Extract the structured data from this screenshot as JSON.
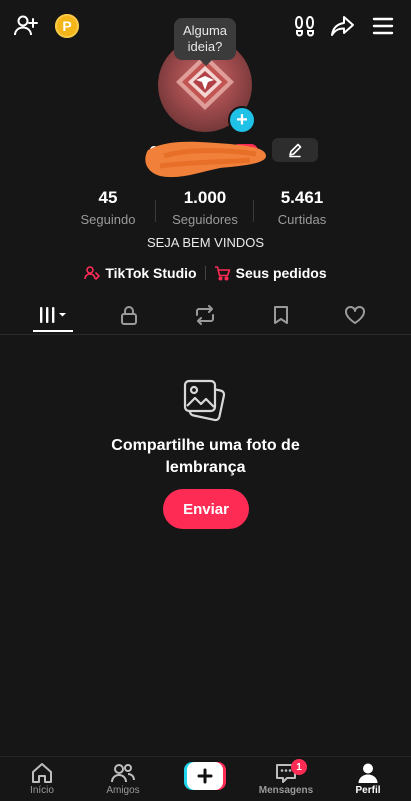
{
  "header": {
    "coin_label": "P"
  },
  "profile": {
    "tooltip": "Alguma ideia?",
    "add_avatar_symbol": "+",
    "bio": "SEJA BEM VINDOS"
  },
  "stats": [
    {
      "value": "45",
      "label": "Seguindo"
    },
    {
      "value": "1.000",
      "label": "Seguidores"
    },
    {
      "value": "5.461",
      "label": "Curtidas"
    }
  ],
  "links": {
    "studio": "TikTok Studio",
    "orders": "Seus pedidos"
  },
  "empty_state": {
    "text_line1": "Compartilhe uma foto de",
    "text_line2": "lembrança",
    "button": "Enviar"
  },
  "bottom_nav": {
    "items": [
      {
        "label": "Início",
        "icon": "home-icon"
      },
      {
        "label": "Amigos",
        "icon": "friends-icon"
      },
      {
        "label": "",
        "icon": "create-icon"
      },
      {
        "label": "Mensagens",
        "icon": "inbox-icon"
      },
      {
        "label": "Perfil",
        "icon": "profile-icon"
      }
    ],
    "messages_badge": "1"
  },
  "colors": {
    "background": "#161616",
    "accent": "#fe2c55",
    "cyan": "#20c1e6",
    "coin": "#f4b518"
  }
}
